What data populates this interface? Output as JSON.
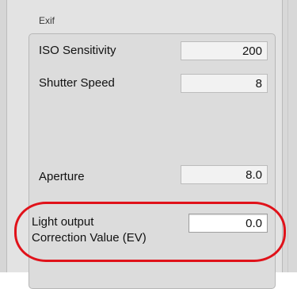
{
  "exif": {
    "title": "Exif",
    "fields": [
      {
        "label": "ISO Sensitivity",
        "value": "200"
      },
      {
        "label": "Shutter Speed",
        "value": "8"
      },
      {
        "label": "Aperture",
        "value": "8.0"
      },
      {
        "label_line1": "Light output",
        "label_line2": "Correction Value (EV)",
        "value": "0.0"
      }
    ]
  },
  "annotation": {
    "color": "#e0121a"
  }
}
